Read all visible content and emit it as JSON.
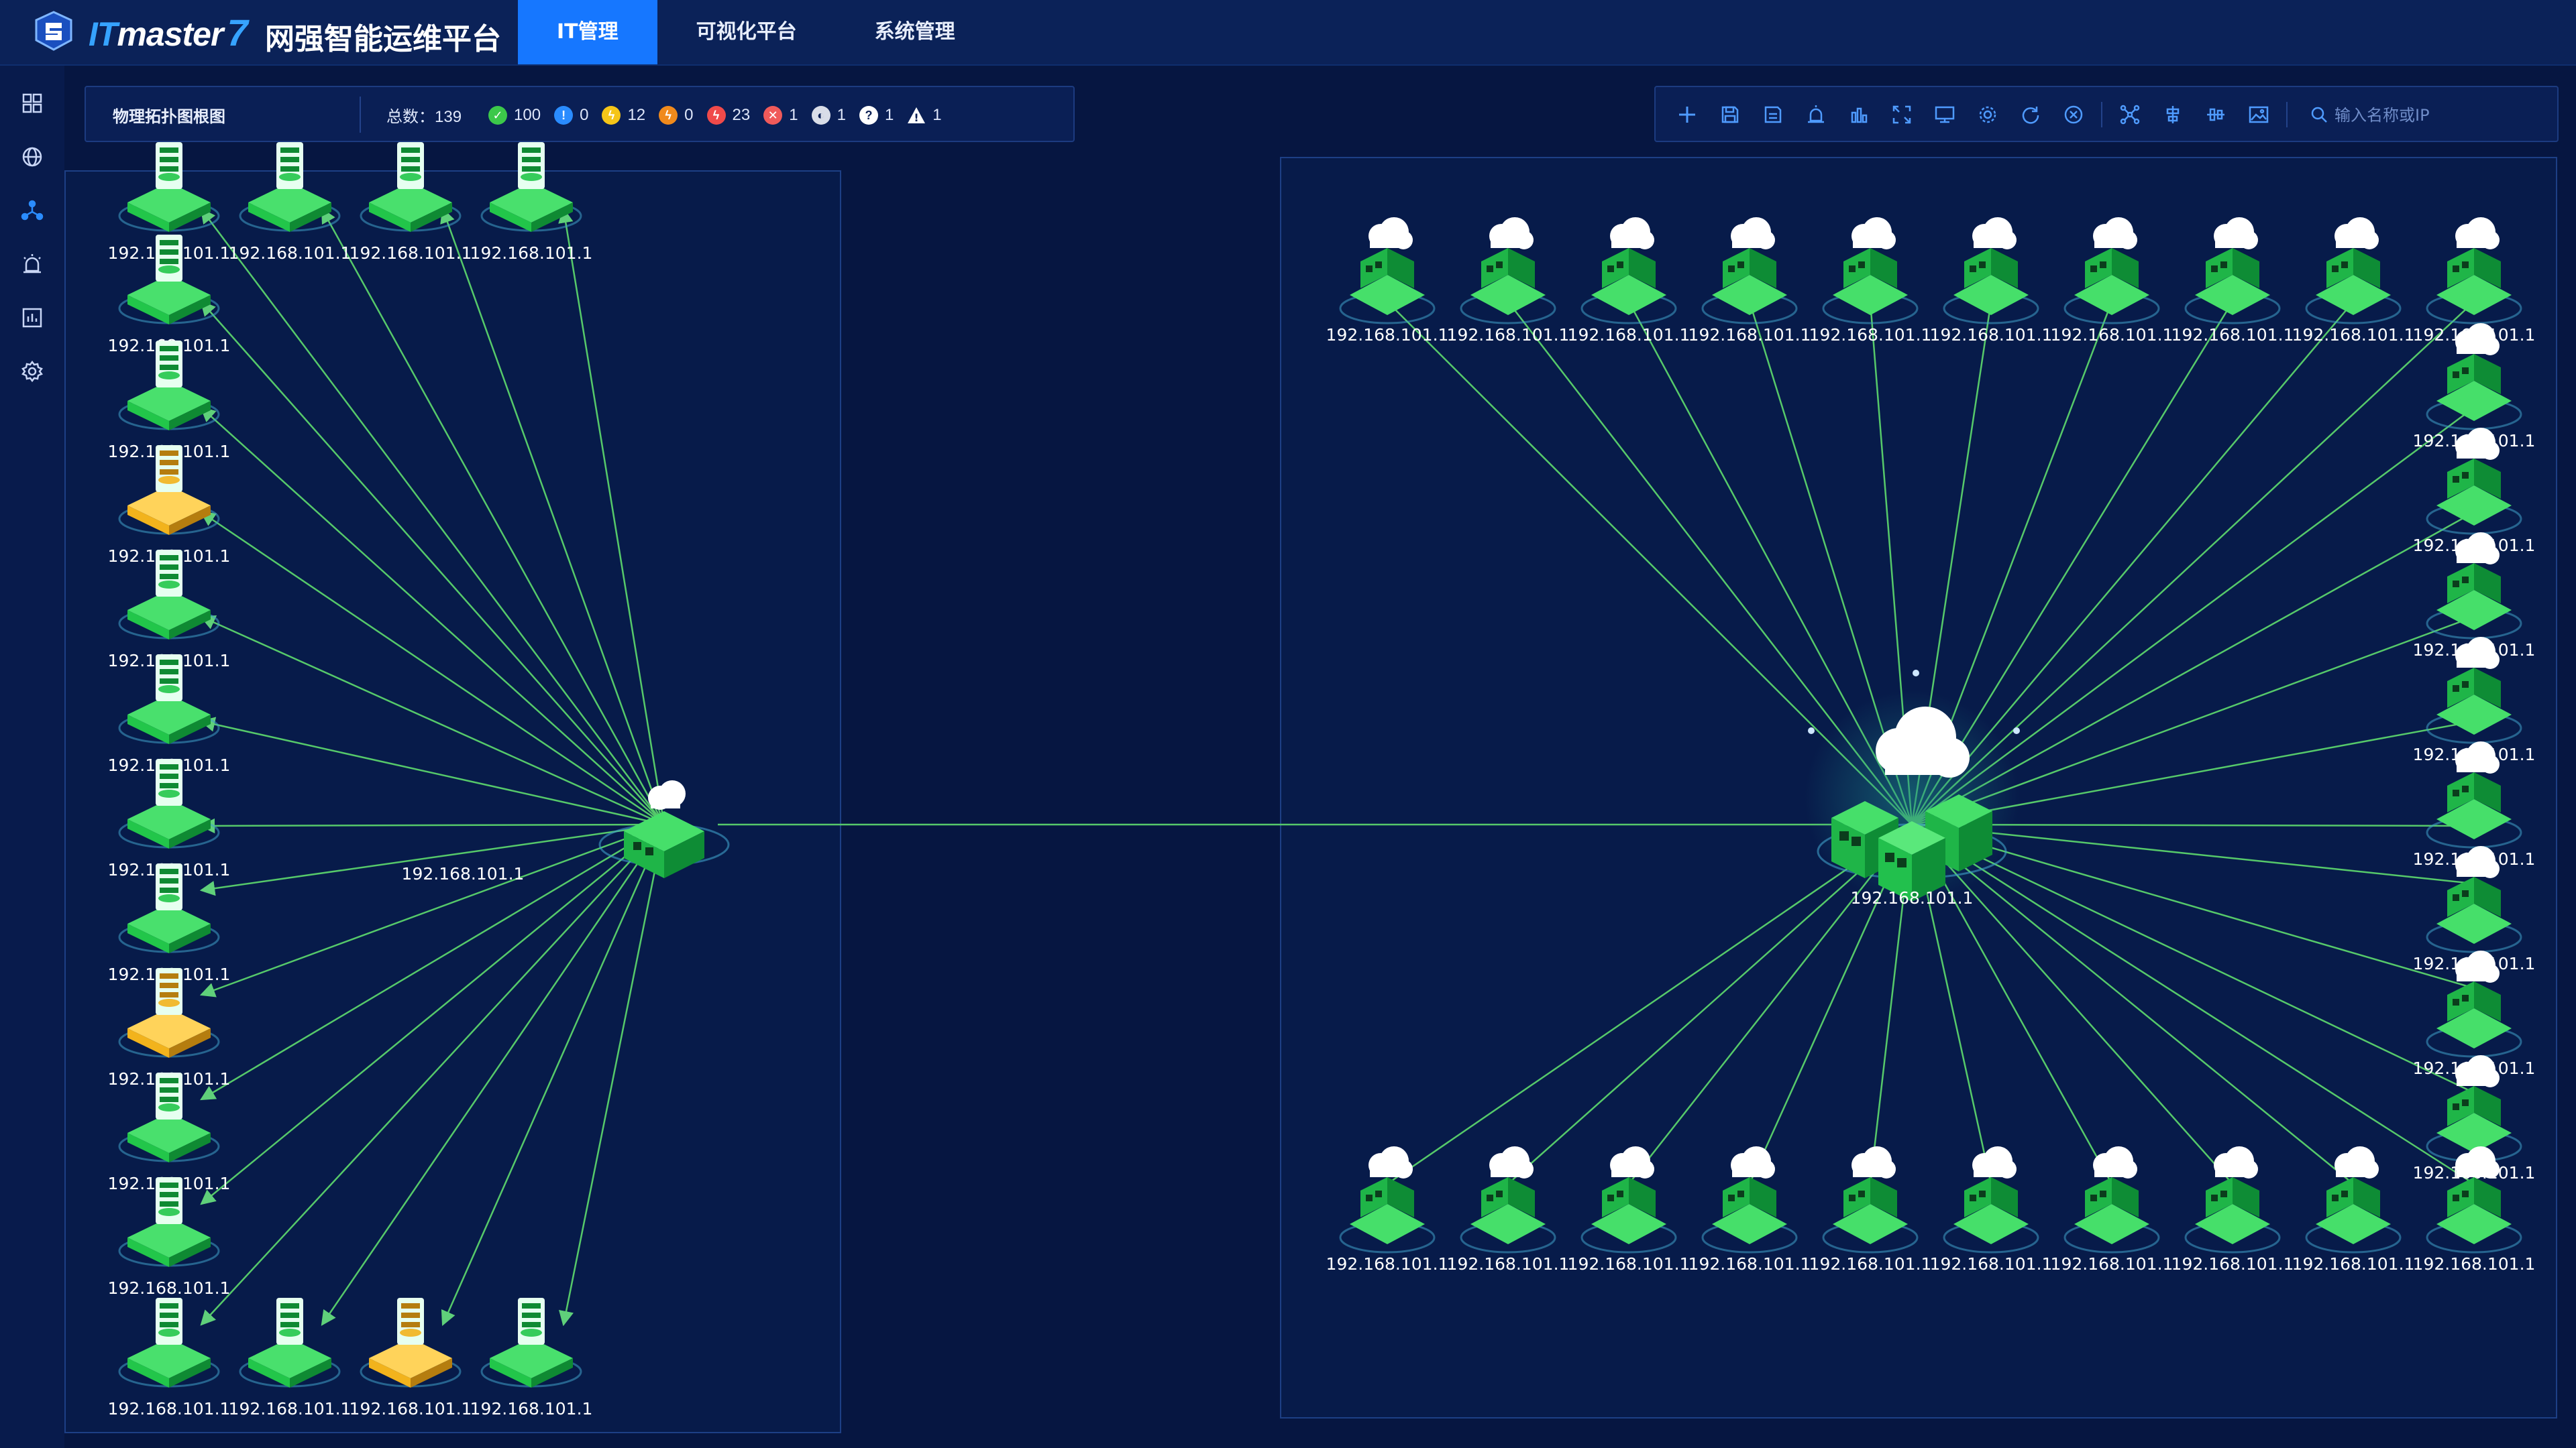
{
  "header": {
    "brand_it": "IT",
    "brand_rest": "master",
    "brand_seven": "7",
    "product": "网强智能运维平台",
    "nav": [
      {
        "label": "IT管理",
        "active": true
      },
      {
        "label": "可视化平台",
        "active": false
      },
      {
        "label": "系统管理",
        "active": false
      }
    ]
  },
  "rail": {
    "icons": [
      "dashboard-icon",
      "globe-icon",
      "topology-icon",
      "alarm-icon",
      "report-icon",
      "settings-icon"
    ]
  },
  "stats": {
    "title": "物理拓扑图根图",
    "total_label": "总数：139",
    "items": [
      {
        "icon": "ok-icon",
        "color": "#3cc84a",
        "symbol": "✓",
        "value": "100"
      },
      {
        "icon": "info-icon",
        "color": "#2a8cff",
        "symbol": "!",
        "value": "0"
      },
      {
        "icon": "warning-icon",
        "color": "#f5c518",
        "symbol": "⚡",
        "value": "12"
      },
      {
        "icon": "minor-icon",
        "color": "#f08a1c",
        "symbol": "⚡",
        "value": "0"
      },
      {
        "icon": "critical-icon",
        "color": "#f04a4a",
        "symbol": "⚡",
        "value": "23"
      },
      {
        "icon": "down-icon",
        "color": "#f05a5a",
        "symbol": "✕",
        "value": "1"
      },
      {
        "icon": "unmanaged-icon",
        "color": "#d9dde8",
        "symbol": "◐",
        "value": "1"
      },
      {
        "icon": "unknown-icon",
        "color": "#ffffff",
        "symbol": "?",
        "value": "1"
      },
      {
        "icon": "alert-icon",
        "color": "#ffffff",
        "symbol": "!",
        "value": "1"
      }
    ]
  },
  "toolbar": {
    "icons": [
      "add-icon",
      "save-icon",
      "save-as-icon",
      "alarm-icon",
      "chart-icon",
      "fullscreen-icon",
      "monitor-icon",
      "settings-icon",
      "refresh-icon",
      "close-icon",
      "layout-icon",
      "align-horizontal-icon",
      "align-vertical-icon",
      "image-icon"
    ],
    "search_placeholder": "输入名称或IP"
  },
  "topology": {
    "node_label": "192.168.101.1",
    "colors": {
      "normal": "#22c64a",
      "warning": "#f2b31c",
      "link": "#56c96a"
    },
    "left_hub_label": "192.168.101.1",
    "right_hub_label": "192.168.101.1",
    "left_nodes_status": [
      "normal",
      "normal",
      "normal",
      "normal",
      "normal",
      "normal",
      "warning",
      "normal",
      "normal",
      "normal",
      "normal",
      "warning",
      "normal",
      "normal",
      "normal",
      "normal",
      "warning",
      "normal"
    ],
    "right_nodes_count": 28
  }
}
